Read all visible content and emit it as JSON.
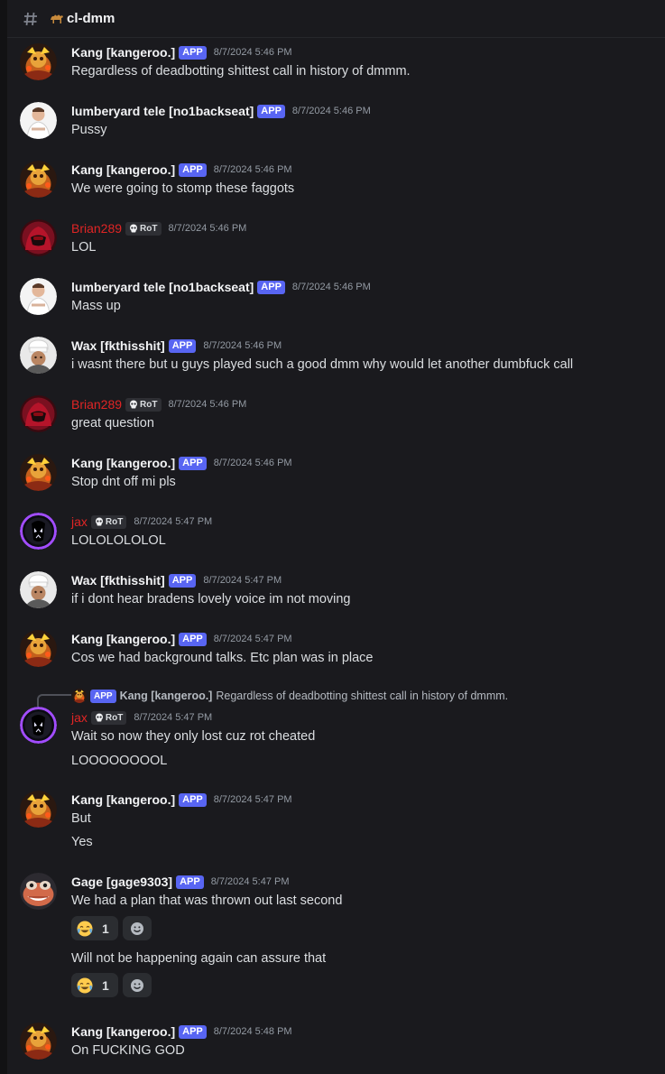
{
  "channel": {
    "name": "cl-dmm",
    "hash_icon": "hash-icon",
    "emoji_icon": "camel-emoji-icon"
  },
  "tags": {
    "app": "APP",
    "rot": "RoT"
  },
  "messages": [
    {
      "author": "Kang [kangeroo.]",
      "tag": "APP",
      "time": "8/7/2024 5:46 PM",
      "text": "Regardless of deadbotting shittest call in history of dmmm."
    },
    {
      "author": "lumberyard tele [no1backseat]",
      "tag": "APP",
      "time": "8/7/2024 5:46 PM",
      "text": "Pussy"
    },
    {
      "author": "Kang [kangeroo.]",
      "tag": "APP",
      "time": "8/7/2024 5:46 PM",
      "text": "We were going to stomp these faggots"
    },
    {
      "author": "Brian289",
      "tag": "RoT",
      "time": "8/7/2024 5:46 PM",
      "text": "LOL"
    },
    {
      "author": "lumberyard tele [no1backseat]",
      "tag": "APP",
      "time": "8/7/2024 5:46 PM",
      "text": "Mass up"
    },
    {
      "author": "Wax [fkthisshit]",
      "tag": "APP",
      "time": "8/7/2024 5:46 PM",
      "text": "i wasnt there but u guys played such a good dmm why would let another dumbfuck call"
    },
    {
      "author": "Brian289",
      "tag": "RoT",
      "time": "8/7/2024 5:46 PM",
      "text": "great question"
    },
    {
      "author": "Kang [kangeroo.]",
      "tag": "APP",
      "time": "8/7/2024 5:46 PM",
      "text": "Stop dnt off mi pls"
    },
    {
      "author": "jax",
      "tag": "RoT",
      "time": "8/7/2024 5:47 PM",
      "text": "LOLOLOLOLOL"
    },
    {
      "author": "Wax [fkthisshit]",
      "tag": "APP",
      "time": "8/7/2024 5:47 PM",
      "text": "if i dont hear bradens lovely voice im not moving"
    },
    {
      "author": "Kang [kangeroo.]",
      "tag": "APP",
      "time": "8/7/2024 5:47 PM",
      "text": "Cos we had background talks. Etc plan was in place"
    },
    {
      "reply": {
        "tag": "APP",
        "author": "Kang [kangeroo.]",
        "text": "Regardless of deadbotting shittest call in history of dmmm."
      },
      "author": "jax",
      "tag": "RoT",
      "time": "8/7/2024 5:47 PM",
      "text": "Wait so now they only lost cuz rot cheated",
      "text2": "LOOOOOOOOL"
    },
    {
      "author": "Kang [kangeroo.]",
      "tag": "APP",
      "time": "8/7/2024 5:47 PM",
      "text": "But",
      "text2": "Yes"
    },
    {
      "author": "Gage [gage9303]",
      "tag": "APP",
      "time": "8/7/2024 5:47 PM",
      "text": "We had a plan that was thrown out last second",
      "reaction1": {
        "emoji": "joy-emoji-icon",
        "count": "1"
      },
      "text2": "Will not be happening again can assure that",
      "reaction2": {
        "emoji": "joy-emoji-icon",
        "count": "1"
      }
    },
    {
      "author": "Kang [kangeroo.]",
      "tag": "APP",
      "time": "8/7/2024 5:48 PM",
      "text": "On FUCKING GOD"
    }
  ],
  "colors": {
    "background": "#1a1a1e",
    "app_tag": "#5865f2",
    "red_name": "#e02525",
    "timestamp": "#949ba4"
  }
}
